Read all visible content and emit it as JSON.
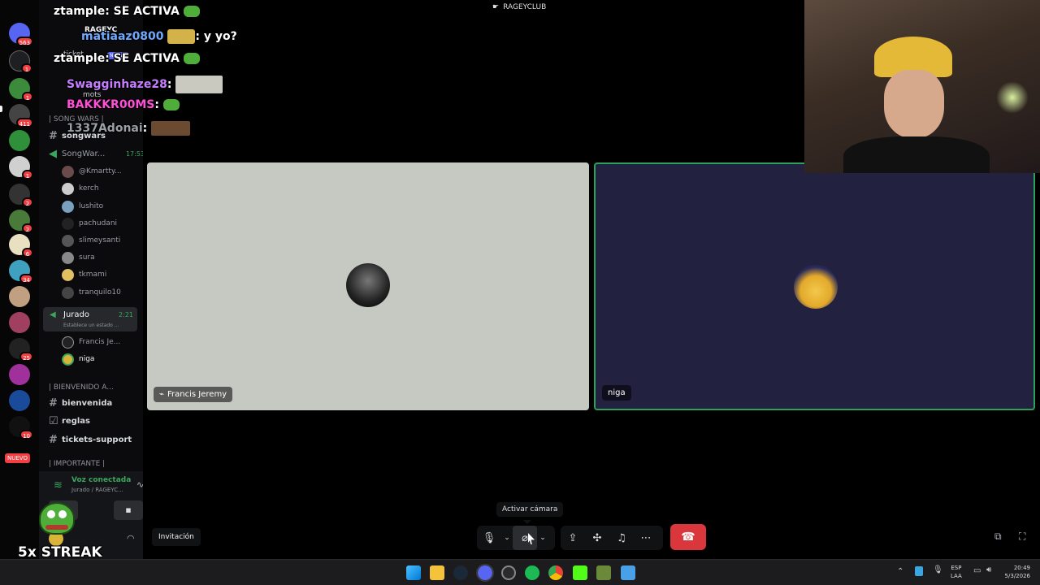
{
  "window": {
    "title": "RAGEYCLUB"
  },
  "server_badges": [
    "563",
    "1",
    "1",
    "411",
    "1",
    "2",
    "2",
    "6",
    "34",
    "25",
    "10",
    "NUEVO"
  ],
  "overlay_chat": [
    {
      "user": "ztample",
      "message": ": SE ACTIVA",
      "color": "#ffffff"
    },
    {
      "user": "matiaaz0800",
      "message": ": y yo?",
      "color": "#6ea8ff"
    },
    {
      "user": "ztample",
      "message": ": SE ACTIVA",
      "color": "#ffffff"
    },
    {
      "user": "Swagginhaze28",
      "message": ":",
      "color": "#c77dff"
    },
    {
      "user": "BAKKKR00MS",
      "message": ":",
      "color": "#ff4fd8"
    },
    {
      "user": "1337Adonai",
      "message": ":",
      "color": "#9aa0a6"
    }
  ],
  "sidebar": {
    "server_name": "RAGEYC",
    "peek_items": [
      "ticket",
      "mots"
    ],
    "peek_badge": "NUEVO",
    "categories": {
      "song_wars": "| SONG WARS |",
      "bienvenida": "| BIENVENIDO A...",
      "importante": "| IMPORTANTE |"
    },
    "channels": {
      "songwars": "songwars",
      "bienvenida": "bienvenida",
      "reglas": "reglas",
      "tickets": "tickets-support"
    },
    "voice_songwars": {
      "name": "SongWar...",
      "time": "17:53"
    },
    "songwars_members": [
      "@Kmartty...",
      "kerch",
      "lushito",
      "pachudani",
      "slimeysanti",
      "sura",
      "tkmami",
      "tranquilo10"
    ],
    "voice_jurado": {
      "name": "Jurado",
      "time": "2:21",
      "status": "Establece un estado ..."
    },
    "jurado_members": [
      "Francis Je...",
      "niga"
    ]
  },
  "voice_panel": {
    "status": "Voz conectada",
    "sub": "Jurado / RAGEYC...",
    "streak": "5x STREAK"
  },
  "tiles": {
    "left_name": "Francis Jeremy",
    "right_name": "niga"
  },
  "toolbar": {
    "invite_label": "Invitación",
    "tooltip": "Activar cámara"
  },
  "taskbar": {
    "lang_top": "ESP",
    "lang_bottom": "LAA",
    "time": "20:49",
    "date": "5/3/2026"
  }
}
